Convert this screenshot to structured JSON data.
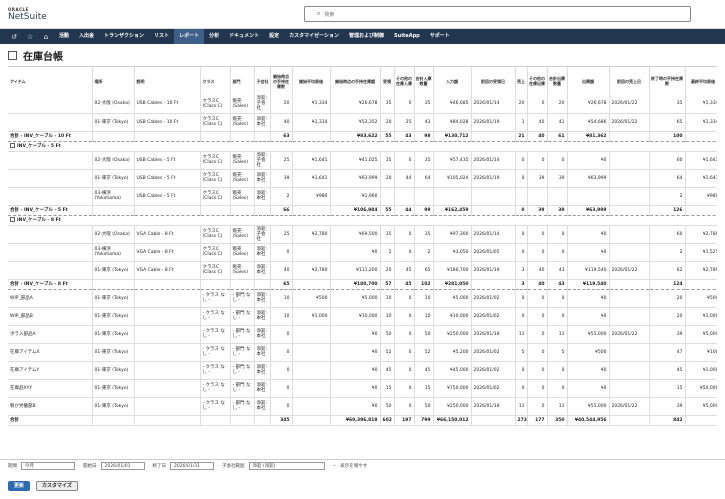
{
  "header": {
    "oracle": "ORACLE",
    "brand": "NetSuite",
    "search_placeholder": "検索"
  },
  "nav": [
    "活動",
    "入出金",
    "トランザクション",
    "リスト",
    "レポート",
    "分析",
    "ドキュメント",
    "設定",
    "カスタマイゼーション",
    "管理および制御",
    "SuiteApp",
    "サポート"
  ],
  "page": {
    "title": "在庫台帳"
  },
  "columns": [
    "アイテム",
    "場所",
    "説明",
    "クラス",
    "部門",
    "子会社",
    "開始時点の手持在庫数",
    "開始平均原価",
    "開始時点の手持在庫額",
    "受領",
    "その他の在庫入庫",
    "合計入庫数量",
    "入力額",
    "前回の受領日",
    "売上",
    "その他の在庫出庫",
    "合計出庫数量",
    "出庫額",
    "前回の売上日",
    "終了時の手持在庫数",
    "最終平均原価"
  ],
  "rows": [
    {
      "t": "r",
      "c": [
        "",
        "02-大阪 (Osaka)",
        "USB Cables - 10 Ft",
        "クラスC (Class C)",
        "販売 (Sales)",
        "添鉛:子会社",
        "20",
        "¥1,334",
        "¥26,678",
        "35",
        "0",
        "35",
        "¥46,685",
        "2026/01/14",
        "20",
        "0",
        "20",
        "¥26,678",
        "2026/01/22",
        "35",
        "¥1,334"
      ]
    },
    {
      "t": "r",
      "c": [
        "",
        "01-東京 (Tokyo)",
        "USB Cables - 10 Ft",
        "クラスC (Class C)",
        "販売 (Sales)",
        "添鉛:本社",
        "40",
        "¥1,334",
        "¥53,352",
        "20",
        "25",
        "43",
        "¥84,028",
        "2026/01/19",
        "1",
        "40",
        "41",
        "¥54,686",
        "2026/01/22",
        "65",
        "¥1,334"
      ]
    },
    {
      "t": "s",
      "c": [
        "合計 - INV_ケーブル - 10 Ft",
        "",
        "",
        "",
        "",
        "",
        "63",
        "",
        "¥83,622",
        "55",
        "43",
        "98",
        "¥130,712",
        "",
        "21",
        "40",
        "61",
        "¥81,362",
        "",
        "100",
        ""
      ]
    },
    {
      "t": "g",
      "c": [
        "INV_ケーブル - 5 Ft"
      ]
    },
    {
      "t": "r",
      "c": [
        "",
        "02-大阪 (Osaka)",
        "USB Cables - 5 Ft",
        "クラスC (Class C)",
        "販売 (Sales)",
        "添鉛:子会社",
        "25",
        "¥1,641",
        "¥41,025",
        "35",
        "0",
        "35",
        "¥57,435",
        "2026/01/14",
        "0",
        "0",
        "0",
        "¥0",
        "",
        "60",
        "¥1,641"
      ]
    },
    {
      "t": "r",
      "c": [
        "",
        "01-東京 (Tokyo)",
        "USB Cables - 5 Ft",
        "クラスC (Class C)",
        "販売 (Sales)",
        "添鉛:本社",
        "39",
        "¥1,641",
        "¥63,999",
        "20",
        "44",
        "64",
        "¥105,024",
        "2026/01/19",
        "0",
        "39",
        "39",
        "¥63,999",
        "",
        "64",
        "¥1,641"
      ]
    },
    {
      "t": "r",
      "c": [
        "",
        "03-横浜 (Yokohama)",
        "USB Cables - 5 Ft",
        "クラスC (Class C)",
        "販売 (Sales)",
        "添鉛:本社",
        "2",
        "¥980",
        "¥1,960",
        "",
        "",
        "",
        "",
        "",
        "",
        "",
        "",
        "",
        "",
        "2",
        "¥980"
      ]
    },
    {
      "t": "s",
      "c": [
        "合計 - INV_ケーブル - 5 Ft",
        "",
        "",
        "",
        "",
        "",
        "66",
        "",
        "¥106,984",
        "55",
        "44",
        "99",
        "¥162,459",
        "",
        "0",
        "39",
        "39",
        "¥63,999",
        "",
        "126",
        ""
      ]
    },
    {
      "t": "g",
      "c": [
        "INV_ケーブル - 8 Ft"
      ]
    },
    {
      "t": "r",
      "c": [
        "",
        "02-大阪 (Osaka)",
        "VGA Cable - 8 Ft",
        "クラスC (Class C)",
        "販売 (Sales)",
        "添鉛:子会社",
        "25",
        "¥2,780",
        "¥69,500",
        "35",
        "0",
        "35",
        "¥97,300",
        "2026/01/14",
        "0",
        "0",
        "0",
        "¥0",
        "",
        "60",
        "¥2,780"
      ]
    },
    {
      "t": "r",
      "c": [
        "",
        "03-横浜 (Yokohama)",
        "VGA Cable - 8 Ft",
        "クラスC (Class C)",
        "販売 (Sales)",
        "添鉛:本社",
        "0",
        "",
        "¥0",
        "2",
        "0",
        "2",
        "¥3,050",
        "2026/01/05",
        "0",
        "0",
        "0",
        "¥0",
        "",
        "2",
        "¥1,525"
      ]
    },
    {
      "t": "r",
      "c": [
        "",
        "01-東京 (Tokyo)",
        "VGA Cable - 8 Ft",
        "クラスC (Class C)",
        "販売 (Sales)",
        "添鉛:本社",
        "40",
        "¥2,780",
        "¥111,200",
        "20",
        "45",
        "65",
        "¥180,700",
        "2026/01/19",
        "3",
        "40",
        "43",
        "¥119,540",
        "2026/01/22",
        "62",
        "¥2,780"
      ]
    },
    {
      "t": "s",
      "c": [
        "合計 - INV_ケーブル - 8 Ft",
        "",
        "",
        "",
        "",
        "",
        "65",
        "",
        "¥180,700",
        "57",
        "45",
        "102",
        "¥281,050",
        "",
        "3",
        "40",
        "43",
        "¥119,540",
        "",
        "124",
        ""
      ]
    },
    {
      "t": "r",
      "c": [
        "WIP_部品A",
        "01-東京 (Tokyo)",
        "",
        "- クラス なし -",
        "- 部門 なし -",
        "添鉛:本社",
        "10",
        "¥500",
        "¥5,000",
        "10",
        "0",
        "10",
        "¥5,000",
        "2026/01/02",
        "0",
        "0",
        "0",
        "¥0",
        "",
        "20",
        "¥500"
      ]
    },
    {
      "t": "r",
      "c": [
        "WIP_部品B",
        "01-東京 (Tokyo)",
        "",
        "- クラス なし -",
        "- 部門 なし -",
        "添鉛:本社",
        "10",
        "¥1,000",
        "¥10,000",
        "10",
        "0",
        "10",
        "¥10,000",
        "2026/01/02",
        "0",
        "0",
        "0",
        "¥0",
        "",
        "20",
        "¥1,000"
      ]
    },
    {
      "t": "r",
      "c": [
        "ボラ入部品A",
        "01-東京 (Tokyo)",
        "",
        "- クラス なし -",
        "- 部門 なし -",
        "添鉛:本社",
        "0",
        "",
        "¥0",
        "50",
        "0",
        "50",
        "¥250,000",
        "2026/01/18",
        "11",
        "0",
        "11",
        "¥55,000",
        "2026/01/22",
        "39",
        "¥5,000"
      ]
    },
    {
      "t": "r",
      "c": [
        "在庫アイテムX",
        "01-東京 (Tokyo)",
        "",
        "- クラス なし -",
        "- 部門 なし -",
        "添鉛:本社",
        "0",
        "",
        "¥0",
        "52",
        "0",
        "52",
        "¥5,200",
        "2026/01/02",
        "5",
        "0",
        "5",
        "¥500",
        "",
        "47",
        "¥100"
      ]
    },
    {
      "t": "r",
      "c": [
        "在庫アイテムY",
        "01-東京 (Tokyo)",
        "",
        "- クラス なし -",
        "- 部門 なし -",
        "添鉛:本社",
        "0",
        "",
        "¥0",
        "45",
        "0",
        "45",
        "¥45,000",
        "2026/01/02",
        "0",
        "0",
        "0",
        "¥0",
        "",
        "45",
        "¥1,000"
      ]
    },
    {
      "t": "r",
      "c": [
        "在庫品XYY",
        "01-東京 (Tokyo)",
        "",
        "- クラス なし -",
        "- 部門 なし -",
        "添鉛:本社",
        "0",
        "",
        "¥0",
        "15",
        "0",
        "15",
        "¥750,000",
        "2026/01/02",
        "0",
        "0",
        "0",
        "¥0",
        "",
        "15",
        "¥50,000"
      ]
    },
    {
      "t": "r",
      "c": [
        "製か労働部B",
        "01-東京 (Tokyo)",
        "",
        "- クラス なし -",
        "- 部門 なし -",
        "添鉛:本社",
        "0",
        "",
        "¥0",
        "50",
        "0",
        "50",
        "¥250,000",
        "2026/01/18",
        "11",
        "0",
        "11",
        "¥55,000",
        "2026/01/22",
        "39",
        "¥5,000"
      ]
    },
    {
      "t": "t",
      "c": [
        "合計",
        "",
        "",
        "",
        "",
        "",
        "345",
        "",
        "¥60,396,818",
        "602",
        "197",
        "799",
        "¥66,150,012",
        "",
        "273",
        "177",
        "350",
        "¥40,544,956",
        "",
        "842",
        ""
      ]
    }
  ],
  "footer": {
    "l1": "期間",
    "v1": "今月",
    "l2": "開始日",
    "v2": "2026/01/01",
    "l3": "終了日",
    "v3": "2026/01/31",
    "l4": "子会社範囲",
    "v4": "添鉛 (添鉛)",
    "more": "表示を増やす"
  },
  "buttons": {
    "update": "更新",
    "customize": "カスタマイズ"
  }
}
